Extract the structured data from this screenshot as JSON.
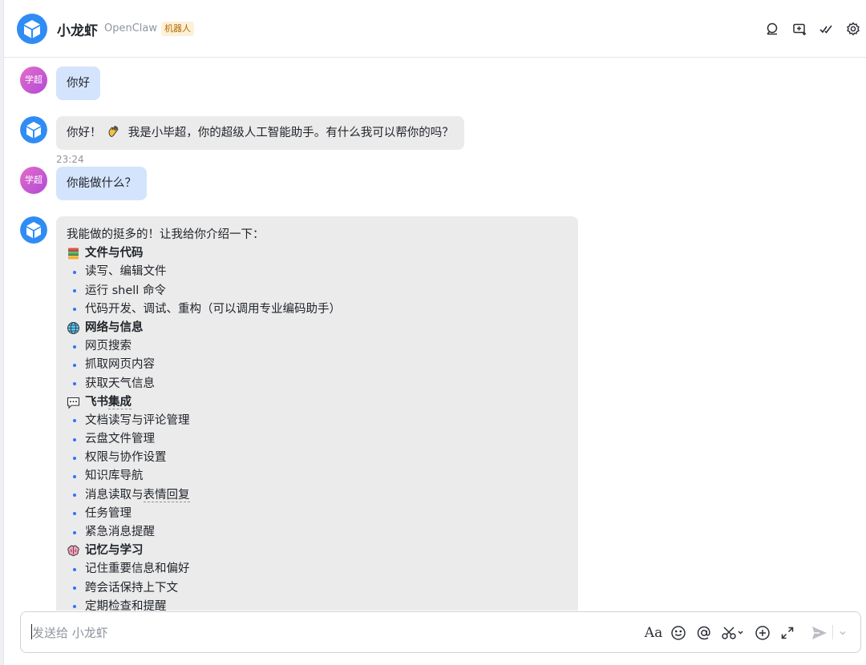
{
  "header": {
    "title": "小龙虾",
    "subtitle": "OpenClaw",
    "tag": "机器人",
    "icons": [
      "search-chat-icon",
      "add-to-group-icon",
      "task-icon",
      "settings-icon"
    ]
  },
  "user": {
    "avatar_text": "学超"
  },
  "messages": {
    "m1": "你好",
    "m2_prefix": "你好！",
    "m2_text": "我是小毕超，你的超级人工智能助手。有什么我可以帮你的吗？",
    "time": "23:24",
    "m3": "你能做什么？",
    "m4": {
      "intro": "我能做的挺多的！让我给你介绍一下：",
      "sections": [
        {
          "icon": "books-icon",
          "title": "文件与代码",
          "items": [
            "读写、编辑文件",
            "运行 shell 命令",
            "代码开发、调试、重构（可以调用专业编码助手）"
          ]
        },
        {
          "icon": "globe-icon",
          "title": "网络与信息",
          "items": [
            "网页搜索",
            "抓取网页内容",
            "获取天气信息"
          ]
        },
        {
          "icon": "speech-bubble-icon",
          "title": "飞书集成",
          "items": [
            "文档读写与评论管理",
            "云盘文件管理",
            "权限与协作设置",
            "知识库导航",
            "消息读取与表情回复",
            "任务管理",
            "紧急消息提醒"
          ]
        },
        {
          "icon": "brain-icon",
          "title": "记忆与学习",
          "items": [
            "记住重要信息和偏好",
            "跨会话保持上下文",
            "定期检查和提醒"
          ]
        }
      ]
    }
  },
  "input": {
    "placeholder": "发送给 小龙虾",
    "format_label": "Aa"
  },
  "colors": {
    "accent": "#3370ff",
    "user_bubble": "#d4e4fd",
    "bot_bubble": "#ebebeb",
    "tag_bg": "#fdf1d9"
  }
}
